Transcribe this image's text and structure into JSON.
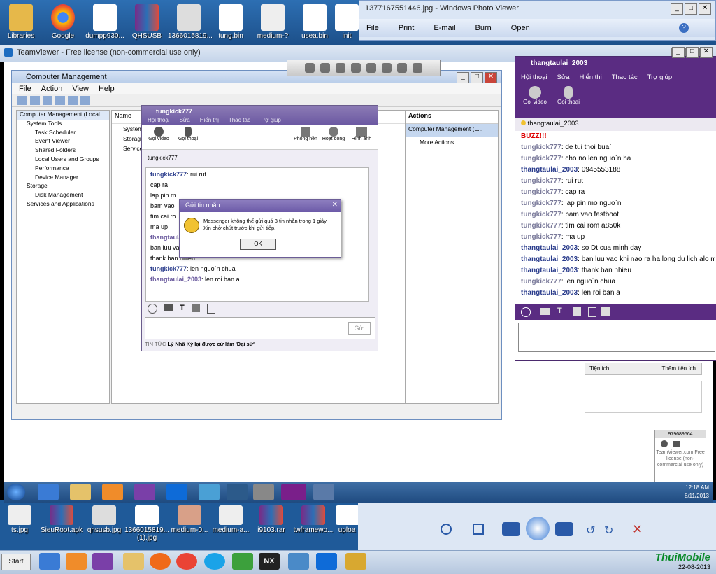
{
  "desktop_icons_top": [
    {
      "label": "Libraries",
      "icon": "folder-icon"
    },
    {
      "label": "Google",
      "icon": "chrome-icon"
    },
    {
      "label": "dumpp930...",
      "icon": "file-icon"
    },
    {
      "label": "QHSUSB",
      "icon": "rar-icon"
    },
    {
      "label": "1366015819...",
      "icon": "image-icon"
    },
    {
      "label": "tung.bin",
      "icon": "file-icon"
    },
    {
      "label": "medium-?",
      "icon": "image-icon"
    },
    {
      "label": "usea.bin",
      "icon": "file-icon"
    },
    {
      "label": "init",
      "icon": "file-icon"
    }
  ],
  "photo_viewer": {
    "title": "1377167551446.jpg - Windows Photo Viewer",
    "menu": [
      "File",
      "Print",
      "E-mail",
      "Burn",
      "Open"
    ]
  },
  "teamviewer": {
    "title": "TeamViewer - Free license (non-commercial use only)"
  },
  "computer_management": {
    "title": "Computer Management",
    "menu": [
      "File",
      "Action",
      "View",
      "Help"
    ],
    "tree": [
      "Computer Management (Local",
      "System Tools",
      "Task Scheduler",
      "Event Viewer",
      "Shared Folders",
      "Local Users and Groups",
      "Performance",
      "Device Manager",
      "Storage",
      "Disk Management",
      "Services and Applications"
    ],
    "list_header": "Name",
    "list_items": [
      "System",
      "Storage",
      "Services"
    ],
    "actions_header": "Actions",
    "actions_selected": "Computer Management (L...",
    "more_actions": "More Actions"
  },
  "ym_small": {
    "contact": "tungkick777",
    "menu": [
      "Hội thoại",
      "Sửa",
      "Hiển thị",
      "Thao tác",
      "Trợ giúp"
    ],
    "tools": [
      "Gọi video",
      "Gọi thoại",
      "Phòng nền",
      "Hoạt động",
      "Hình ảnh"
    ],
    "status_name": "tungkick777",
    "messages": [
      {
        "sender": "tungkick777",
        "text": "rui rut"
      },
      {
        "sender": "",
        "text": "cap ra"
      },
      {
        "sender": "",
        "text": "lap pin m"
      },
      {
        "sender": "",
        "text": "bam vao"
      },
      {
        "sender": "",
        "text": "tim cai ro"
      },
      {
        "sender": "",
        "text": "ma up"
      },
      {
        "sender": "thangtaulai_2003",
        "text": ""
      },
      {
        "sender": "",
        "text": "ban luu va"
      },
      {
        "sender": "",
        "text": "thank ban nhieu"
      },
      {
        "sender": "tungkick777",
        "text": "len nguo`n chua"
      },
      {
        "sender": "thangtaulai_2003",
        "text": "len roi ban a"
      }
    ],
    "send_label": "Gửi",
    "news_label": "TIN TỨC",
    "news_text": "Lý Nhã Kỳ lại được cử làm 'Đại sứ'"
  },
  "dialog": {
    "title": "Gửi tin nhắn",
    "line1": "Messenger không thể gửi quá 3 tin nhắn trong 1 giây.",
    "line2": "Xin chờ chút trước khi gửi tiếp.",
    "ok": "OK"
  },
  "ym_big": {
    "title": "thangtaulai_2003",
    "menu": [
      "Hội thoại",
      "Sửa",
      "Hiển thị",
      "Thao tác",
      "Trợ giúp"
    ],
    "tools": [
      "Gọi video",
      "Gọi thoại"
    ],
    "contact": "thangtaulai_2003",
    "messages": [
      {
        "sender": "BUZZ!!!",
        "text": ""
      },
      {
        "sender": "tungkick777",
        "text": "de tui thoi bua`"
      },
      {
        "sender": "tungkick777",
        "text": "cho no len nguo`n ha"
      },
      {
        "sender": "thangtaulai_2003",
        "text": "0945553188"
      },
      {
        "sender": "tungkick777",
        "text": "rui rut"
      },
      {
        "sender": "tungkick777",
        "text": "cap ra"
      },
      {
        "sender": "tungkick777",
        "text": "lap pin mo nguo`n"
      },
      {
        "sender": "tungkick777",
        "text": "bam vao fastboot"
      },
      {
        "sender": "tungkick777",
        "text": "tim cai rom a850k"
      },
      {
        "sender": "tungkick777",
        "text": "ma up"
      },
      {
        "sender": "thangtaulai_2003",
        "text": "so Dt cua minh day"
      },
      {
        "sender": "thangtaulai_2003",
        "text": "ban luu vao khi nao ra ha long du lich alo m"
      },
      {
        "sender": "thangtaulai_2003",
        "text": "thank ban nhieu"
      },
      {
        "sender": "tungkick777",
        "text": "len nguo`n chua"
      },
      {
        "sender": "thangtaulai_2003",
        "text": "len roi ban a"
      }
    ]
  },
  "tv_side": {
    "tien_ich": "Tiện ích",
    "them_tien_ich": "Thêm tiện ích"
  },
  "tv_panel": {
    "id": "979689564",
    "text": "TeamViewer.com Free license (non-commercial use only)"
  },
  "inner_tray": {
    "time": "12:18 AM",
    "date": "8/11/2013"
  },
  "bottom_icons": [
    {
      "label": "ts.jpg"
    },
    {
      "label": "SieuRoot.apk"
    },
    {
      "label": "qhsusb.jpg"
    },
    {
      "label": "1366015819... (1).jpg"
    },
    {
      "label": "medium-0..."
    },
    {
      "label": "medium-a..."
    },
    {
      "label": "i9103.rar"
    },
    {
      "label": "twframewo..."
    },
    {
      "label": "uploa"
    }
  ],
  "outer_taskbar": {
    "start": "Start",
    "watermark": "ThuiMobile",
    "date": "22-08-2013"
  }
}
